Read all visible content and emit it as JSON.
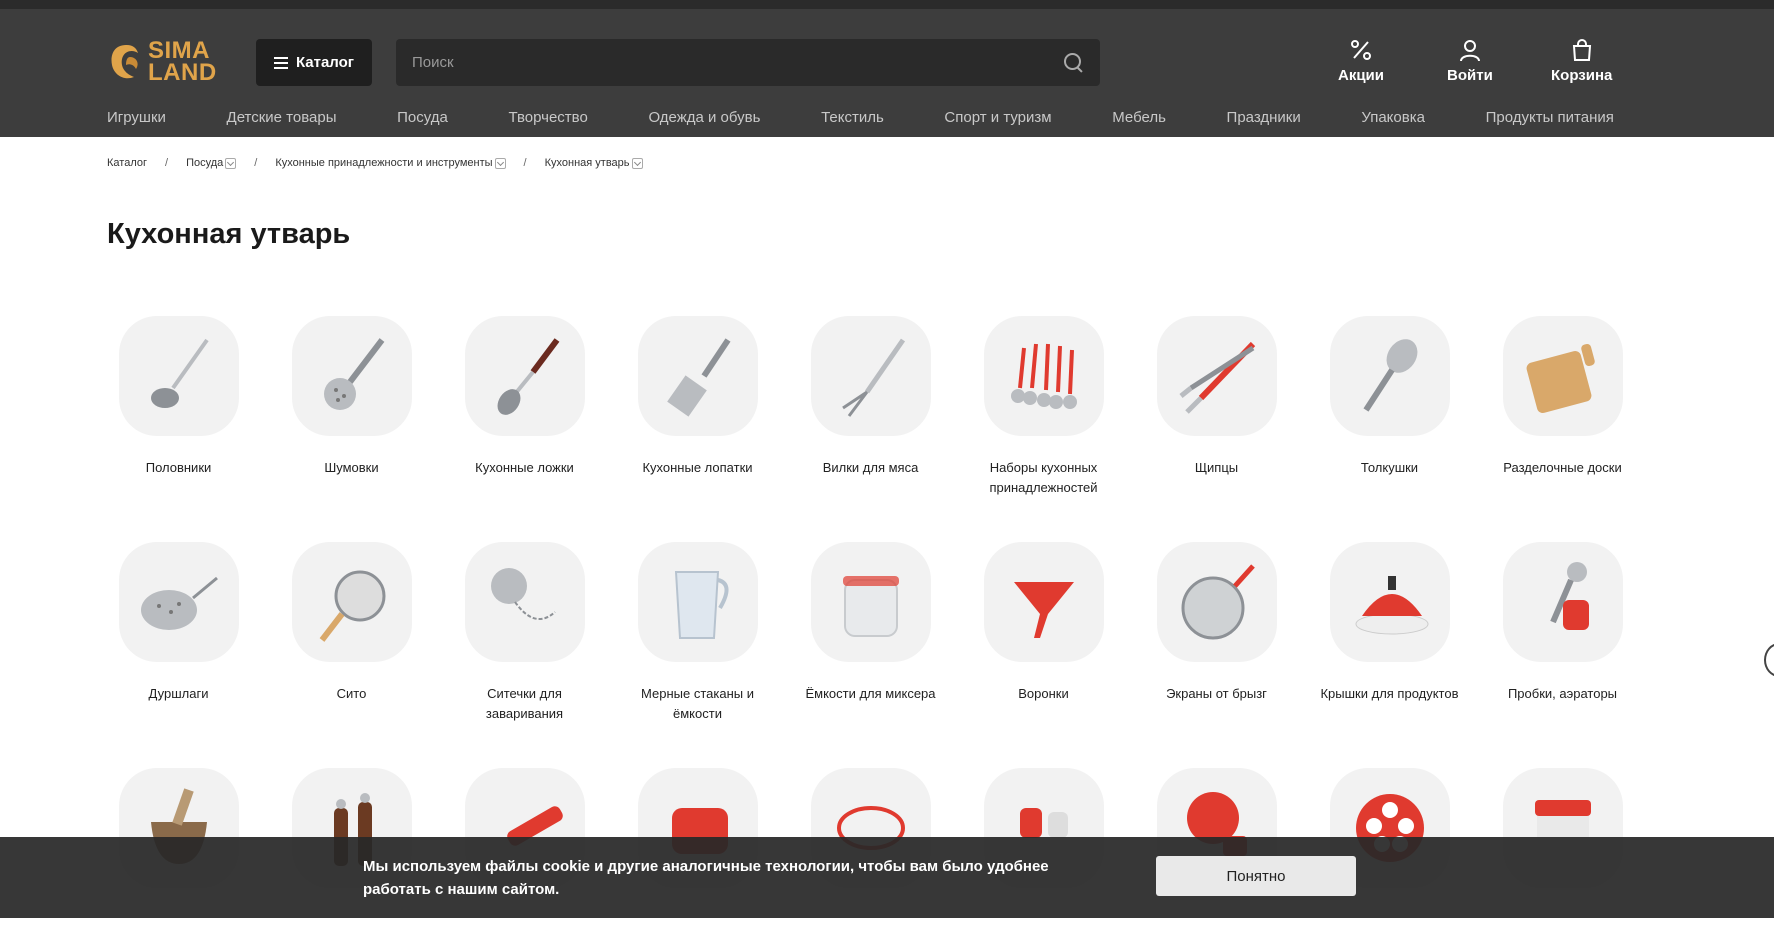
{
  "header": {
    "logo_top": "SIMA",
    "logo_bottom": "LAND",
    "catalog_label": "Каталог",
    "search_placeholder": "Поиск",
    "actions": [
      {
        "label": "Акции",
        "icon": "percent-icon"
      },
      {
        "label": "Войти",
        "icon": "user-icon"
      },
      {
        "label": "Корзина",
        "icon": "bag-icon"
      }
    ]
  },
  "nav": [
    "Игрушки",
    "Детские товары",
    "Посуда",
    "Творчество",
    "Одежда и обувь",
    "Текстиль",
    "Спорт и туризм",
    "Мебель",
    "Праздники",
    "Упаковка",
    "Продукты питания"
  ],
  "breadcrumb": [
    {
      "label": "Каталог",
      "dropdown": false
    },
    {
      "label": "Посуда",
      "dropdown": true
    },
    {
      "label": "Кухонные принадлежности и инструменты",
      "dropdown": true
    },
    {
      "label": "Кухонная утварь",
      "dropdown": true
    }
  ],
  "page_title": "Кухонная утварь",
  "categories": [
    {
      "label": "Половники",
      "icon": "ladle-icon"
    },
    {
      "label": "Шумовки",
      "icon": "skimmer-icon"
    },
    {
      "label": "Кухонные ложки",
      "icon": "spoon-icon"
    },
    {
      "label": "Кухонные лопатки",
      "icon": "spatula-icon"
    },
    {
      "label": "Вилки для мяса",
      "icon": "meat-fork-icon"
    },
    {
      "label": "Наборы кухонных принадлежностей",
      "icon": "utensil-set-icon"
    },
    {
      "label": "Щипцы",
      "icon": "tongs-icon"
    },
    {
      "label": "Толкушки",
      "icon": "masher-icon"
    },
    {
      "label": "Разделочные доски",
      "icon": "cutting-board-icon"
    },
    {
      "label": "Дуршлаги",
      "icon": "colander-icon"
    },
    {
      "label": "Сито",
      "icon": "sieve-icon"
    },
    {
      "label": "Ситечки для заваривания",
      "icon": "tea-infuser-icon"
    },
    {
      "label": "Мерные стаканы и ёмкости",
      "icon": "measuring-jug-icon"
    },
    {
      "label": "Ёмкости для миксера",
      "icon": "mixer-bowl-icon"
    },
    {
      "label": "Воронки",
      "icon": "funnel-icon"
    },
    {
      "label": "Экраны от брызг",
      "icon": "splatter-screen-icon"
    },
    {
      "label": "Крышки для продуктов",
      "icon": "food-lid-icon"
    },
    {
      "label": "Пробки, аэраторы",
      "icon": "wine-stopper-icon"
    },
    {
      "label": "",
      "icon": "mortar-icon"
    },
    {
      "label": "",
      "icon": "pepper-mill-icon"
    },
    {
      "label": "",
      "icon": "red-tool-icon"
    },
    {
      "label": "",
      "icon": "oven-mitt-icon"
    },
    {
      "label": "",
      "icon": "red-cord-icon"
    },
    {
      "label": "",
      "icon": "red-containers-icon"
    },
    {
      "label": "",
      "icon": "red-lid-icon"
    },
    {
      "label": "",
      "icon": "egg-mold-icon"
    },
    {
      "label": "",
      "icon": "red-jar-icon"
    }
  ],
  "cookie": {
    "text": "Мы используем файлы cookie и другие аналогичные технологии, чтобы вам было удобнее работать с нашим сайтом.",
    "button": "Понятно"
  },
  "colors": {
    "header_bg": "#3d3d3d",
    "logo": "#e0a44a",
    "accent_red": "#e03a2f"
  }
}
